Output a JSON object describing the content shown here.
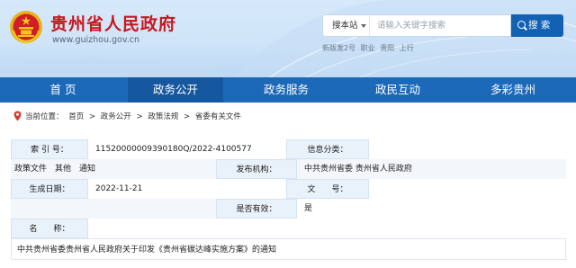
{
  "header": {
    "site_title": "贵州省人民政府",
    "site_domain": "www.guizhou.gov.cn",
    "search": {
      "scope": "搜本站",
      "placeholder": "请输入关键字搜索",
      "button": "搜 索"
    },
    "hot_searches": [
      "新版发2号",
      "职业",
      "贵阳",
      "上行"
    ]
  },
  "nav": {
    "items": [
      "首 页",
      "政务公开",
      "政务服务",
      "政民互动",
      "多彩贵州"
    ],
    "active_index": 1
  },
  "breadcrumb": {
    "label": "当前位置：",
    "path": [
      "首页",
      ">",
      "政务公开",
      ">",
      "政策法规",
      ">",
      "省委有关文件"
    ]
  },
  "info": {
    "index_label": "索 引 号：",
    "index_value": "11520000009390180Q/2022-4100577",
    "category_label": "信息分类：",
    "category_value": "政策文件　其他　通知",
    "issuer_label": "发布机构：",
    "issuer_value": "中共贵州省委 贵州省人民政府",
    "date_label": "生成日期：",
    "date_value": "2022-11-21",
    "docno_label": "文　　号：",
    "docno_value": "",
    "valid_label": "是否有效：",
    "valid_value": "是",
    "title_label": "名　　称：",
    "title_value": "中共贵州省委贵州省人民政府关于印发《贵州省碳达峰实施方案》的通知"
  },
  "colors": {
    "title_red": "#c8161d",
    "nav_blue": "#1c69b9",
    "nav_active": "#1558a0",
    "search_button": "#1261b3",
    "label_bg": "#e9f1fb"
  }
}
